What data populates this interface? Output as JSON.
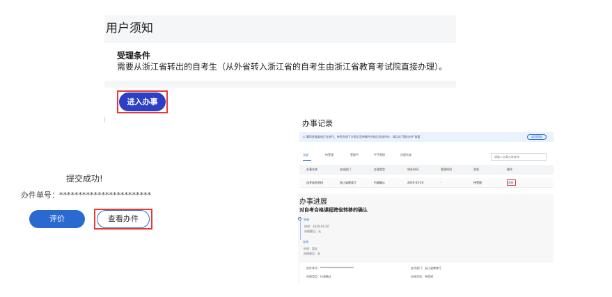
{
  "notice": {
    "title": "用户须知",
    "subtitle": "受理条件",
    "description": "需要从浙江省转出的自考生（从外省转入浙江省的自考生由浙江省教育考试院直接办理）。",
    "enter_button": "进入办事"
  },
  "submit": {
    "success_text": "提交成功!",
    "order_label": "办件单号：************************",
    "rate_button": "评价",
    "view_button": "查看办件"
  },
  "records": {
    "title": "办事记录",
    "notice_text": "① 事项进展查询正在进行，待您办理下方提示及待事件办结后完成评价，请点击\"我的办件\"查看",
    "help_button": "返回帮助",
    "tabs": [
      "全部",
      "待受理",
      "受理中",
      "不予受理",
      "办理完成"
    ],
    "search_placeholder": "请输入办事名称查询",
    "headers": [
      "办事名称",
      "办结部门",
      "办理类型",
      "申办时间",
      "受理时间",
      "状态",
      "操作"
    ],
    "row": [
      "自考省外转档",
      "浙江省教育厅",
      "行政确认",
      "2020-03-20",
      "-",
      "待受理",
      "详情"
    ]
  },
  "progress": {
    "title": "办事进展",
    "subtitle": "对自考合格课程跨省转移的确认",
    "step1": {
      "title": "申请",
      "line1": "时间：2020-03-20",
      "line2": "办理意见：无"
    },
    "step2": {
      "title": "办结",
      "line1": "时间：暂无",
      "line2": "办理意见：无"
    },
    "info": {
      "order_no": "办件单号：************************",
      "dept": "办件部门：浙江省教育厅",
      "type": "办理类型：行政确认",
      "status": "办理状态：待受理"
    }
  }
}
